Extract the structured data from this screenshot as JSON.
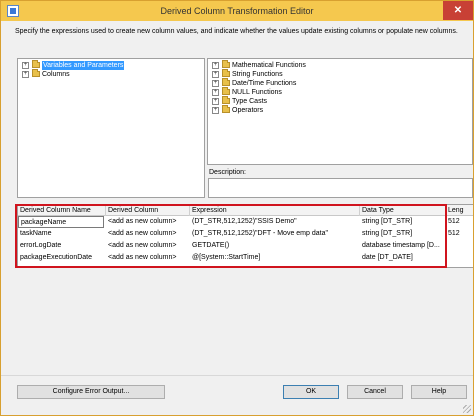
{
  "window": {
    "title": "Derived Column Transformation Editor",
    "close": "✕"
  },
  "instructions": "Specify the expressions used to create new column values, and indicate whether the values update existing columns or populate new columns.",
  "left_tree": [
    {
      "label": "Variables and Parameters",
      "expander": "+"
    },
    {
      "label": "Columns",
      "expander": "+"
    }
  ],
  "right_tree": [
    {
      "label": "Mathematical Functions",
      "expander": "+"
    },
    {
      "label": "String Functions",
      "expander": "+"
    },
    {
      "label": "Date/Time Functions",
      "expander": "+"
    },
    {
      "label": "NULL Functions",
      "expander": "+"
    },
    {
      "label": "Type Casts",
      "expander": "+"
    },
    {
      "label": "Operators",
      "expander": "+"
    }
  ],
  "description_label": "Description:",
  "grid": {
    "headers": [
      "Derived Column Name",
      "Derived Column",
      "Expression",
      "Data Type",
      "Leng"
    ],
    "rows": [
      [
        "packageName",
        "<add as new column>",
        "(DT_STR,512,1252)\"SSIS Demo\"",
        "string [DT_STR]",
        "512"
      ],
      [
        "taskName",
        "<add as new column>",
        "(DT_STR,512,1252)\"DFT - Move emp data\"",
        "string [DT_STR]",
        "512"
      ],
      [
        "errorLogDate",
        "<add as new column>",
        "GETDATE()",
        "database timestamp [D...",
        ""
      ],
      [
        "packageExecutionDate",
        "<add as new column>",
        "@[System::StartTime]",
        "date [DT_DATE]",
        ""
      ]
    ]
  },
  "buttons": {
    "configure_error": "Configure Error Output...",
    "ok": "OK",
    "cancel": "Cancel",
    "help": "Help"
  },
  "colors": {
    "title_bar": "#f5c84e",
    "highlight_border": "#d0141e",
    "selection": "#3399ff"
  }
}
